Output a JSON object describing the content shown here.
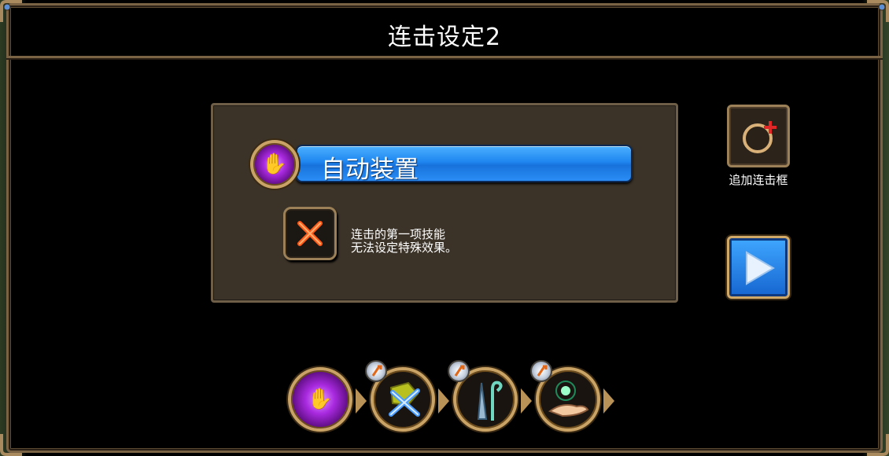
{
  "window": {
    "title": "连击设定2"
  },
  "selected_skill": {
    "name": "自动装置",
    "icon": "purple-hand-orb-icon"
  },
  "notice": {
    "icon": "red-x-icon",
    "line1": "连击的第一项技能",
    "line2": "无法设定特殊效果。"
  },
  "add_combo": {
    "label": "追加连击框",
    "icon": "ring-plus-icon"
  },
  "next_button": {
    "icon": "play-arrow-icon"
  },
  "combo_chain": [
    {
      "icon": "purple-hand-orb-icon",
      "has_badge": false
    },
    {
      "icon": "crossed-swords-icon",
      "has_badge": true
    },
    {
      "icon": "sword-staff-icon",
      "has_badge": true
    },
    {
      "icon": "glowing-hand-icon",
      "has_badge": true
    }
  ],
  "colors": {
    "accent_blue": "#1f86f0",
    "frame_gold": "#c9a265",
    "panel_bg": "#3b3328"
  }
}
